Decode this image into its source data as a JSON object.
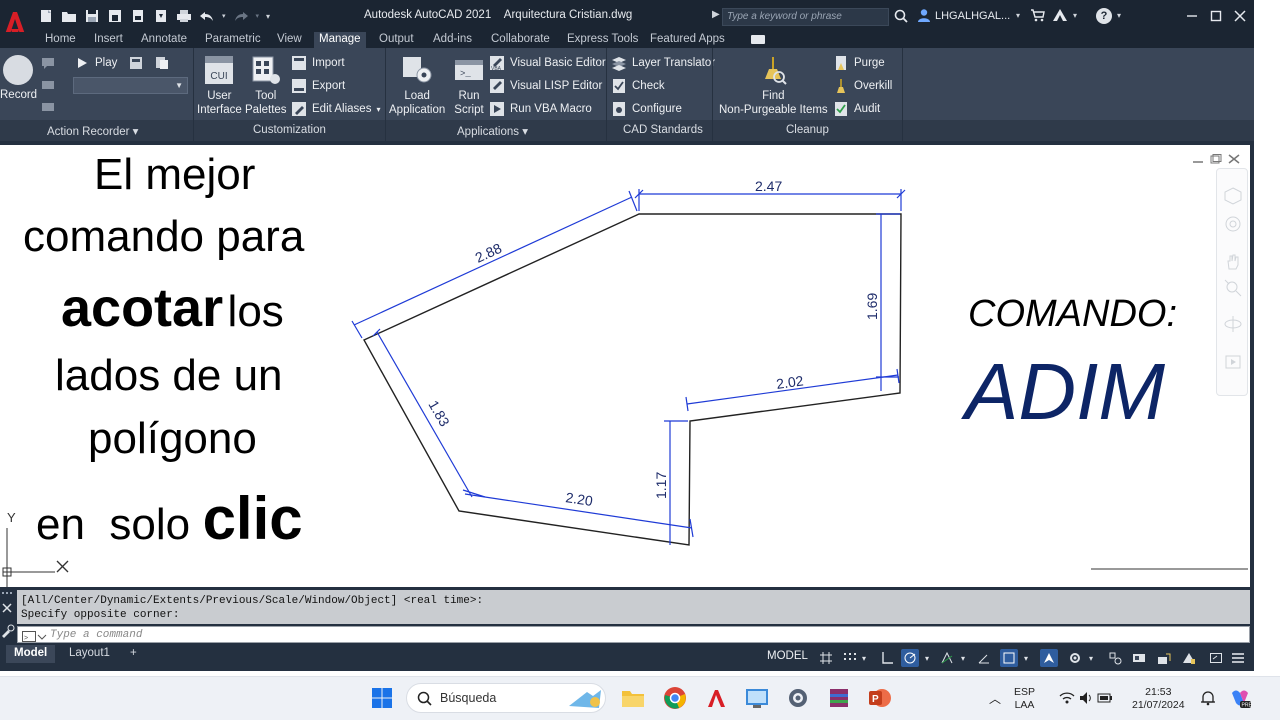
{
  "titlebar": {
    "app_name": "Autodesk AutoCAD 2021",
    "file_name": "Arquitectura Cristian.dwg",
    "search_placeholder": "Type a keyword or phrase",
    "user_name": "LHGALHGAL..."
  },
  "tabs": [
    {
      "label": "Home"
    },
    {
      "label": "Insert"
    },
    {
      "label": "Annotate"
    },
    {
      "label": "Parametric"
    },
    {
      "label": "View"
    },
    {
      "label": "Manage"
    },
    {
      "label": "Output"
    },
    {
      "label": "Add-ins"
    },
    {
      "label": "Collaborate"
    },
    {
      "label": "Express Tools"
    },
    {
      "label": "Featured Apps"
    }
  ],
  "active_tab": "Manage",
  "ribbon": {
    "action_recorder": {
      "title": "Action Recorder",
      "record": "Record",
      "play": "Play"
    },
    "customization": {
      "title": "Customization",
      "user_interface": [
        "User",
        "Interface"
      ],
      "tool_palettes": [
        "Tool",
        "Palettes"
      ],
      "import": "Import",
      "export": "Export",
      "edit_aliases": "Edit Aliases"
    },
    "applications": {
      "title": "Applications",
      "load_application": [
        "Load",
        "Application"
      ],
      "run_script": [
        "Run",
        "Script"
      ],
      "visual_basic_editor": "Visual Basic Editor",
      "visual_lisp_editor": "Visual LISP Editor",
      "run_vba_macro": "Run VBA Macro"
    },
    "cad_standards": {
      "title": "CAD Standards",
      "layer_translator": "Layer Translator",
      "check": "Check",
      "configure": "Configure"
    },
    "cleanup": {
      "title": "Cleanup",
      "find": [
        "Find",
        "Non-Purgeable Items"
      ],
      "purge": "Purge",
      "overkill": "Overkill",
      "audit": "Audit"
    }
  },
  "drawing": {
    "dimensions": {
      "top": "2.47",
      "left_upper": "2.88",
      "right": "1.69",
      "middle": "2.02",
      "left_lower": "1.83",
      "bottom": "2.20",
      "inner_vertical": "1.17"
    },
    "ucs": {
      "y": "Y",
      "x": "X"
    }
  },
  "overlay": {
    "line1": "El mejor",
    "line2": "comando para",
    "line3_bold": "acotar",
    "line3_rest": "los",
    "line4": "lados de un",
    "line5": "polígono",
    "line6_pre": "en  solo",
    "line6_bold": "clic",
    "command_label": "COMANDO:",
    "command_name": "ADIM"
  },
  "command_line": {
    "history": [
      "[All/Center/Dynamic/Extents/Previous/Scale/Window/Object] <real time>:",
      "Specify opposite corner:"
    ],
    "placeholder": "Type a command"
  },
  "layouts": [
    {
      "label": "Model"
    },
    {
      "label": "Layout1"
    },
    {
      "label": "+"
    }
  ],
  "status": {
    "model": "MODEL"
  },
  "taskbar": {
    "search_label": "Búsqueda",
    "lang_top": "ESP",
    "lang_bottom": "LAA",
    "time": "21:53",
    "date": "21/07/2024"
  },
  "colors": {
    "title_bg": "#1b2532",
    "ribbon_bg": "#3a4658",
    "dimension_blue": "#1f3bd6",
    "adim_navy": "#0d2566",
    "autocad_red": "#d81e26"
  }
}
